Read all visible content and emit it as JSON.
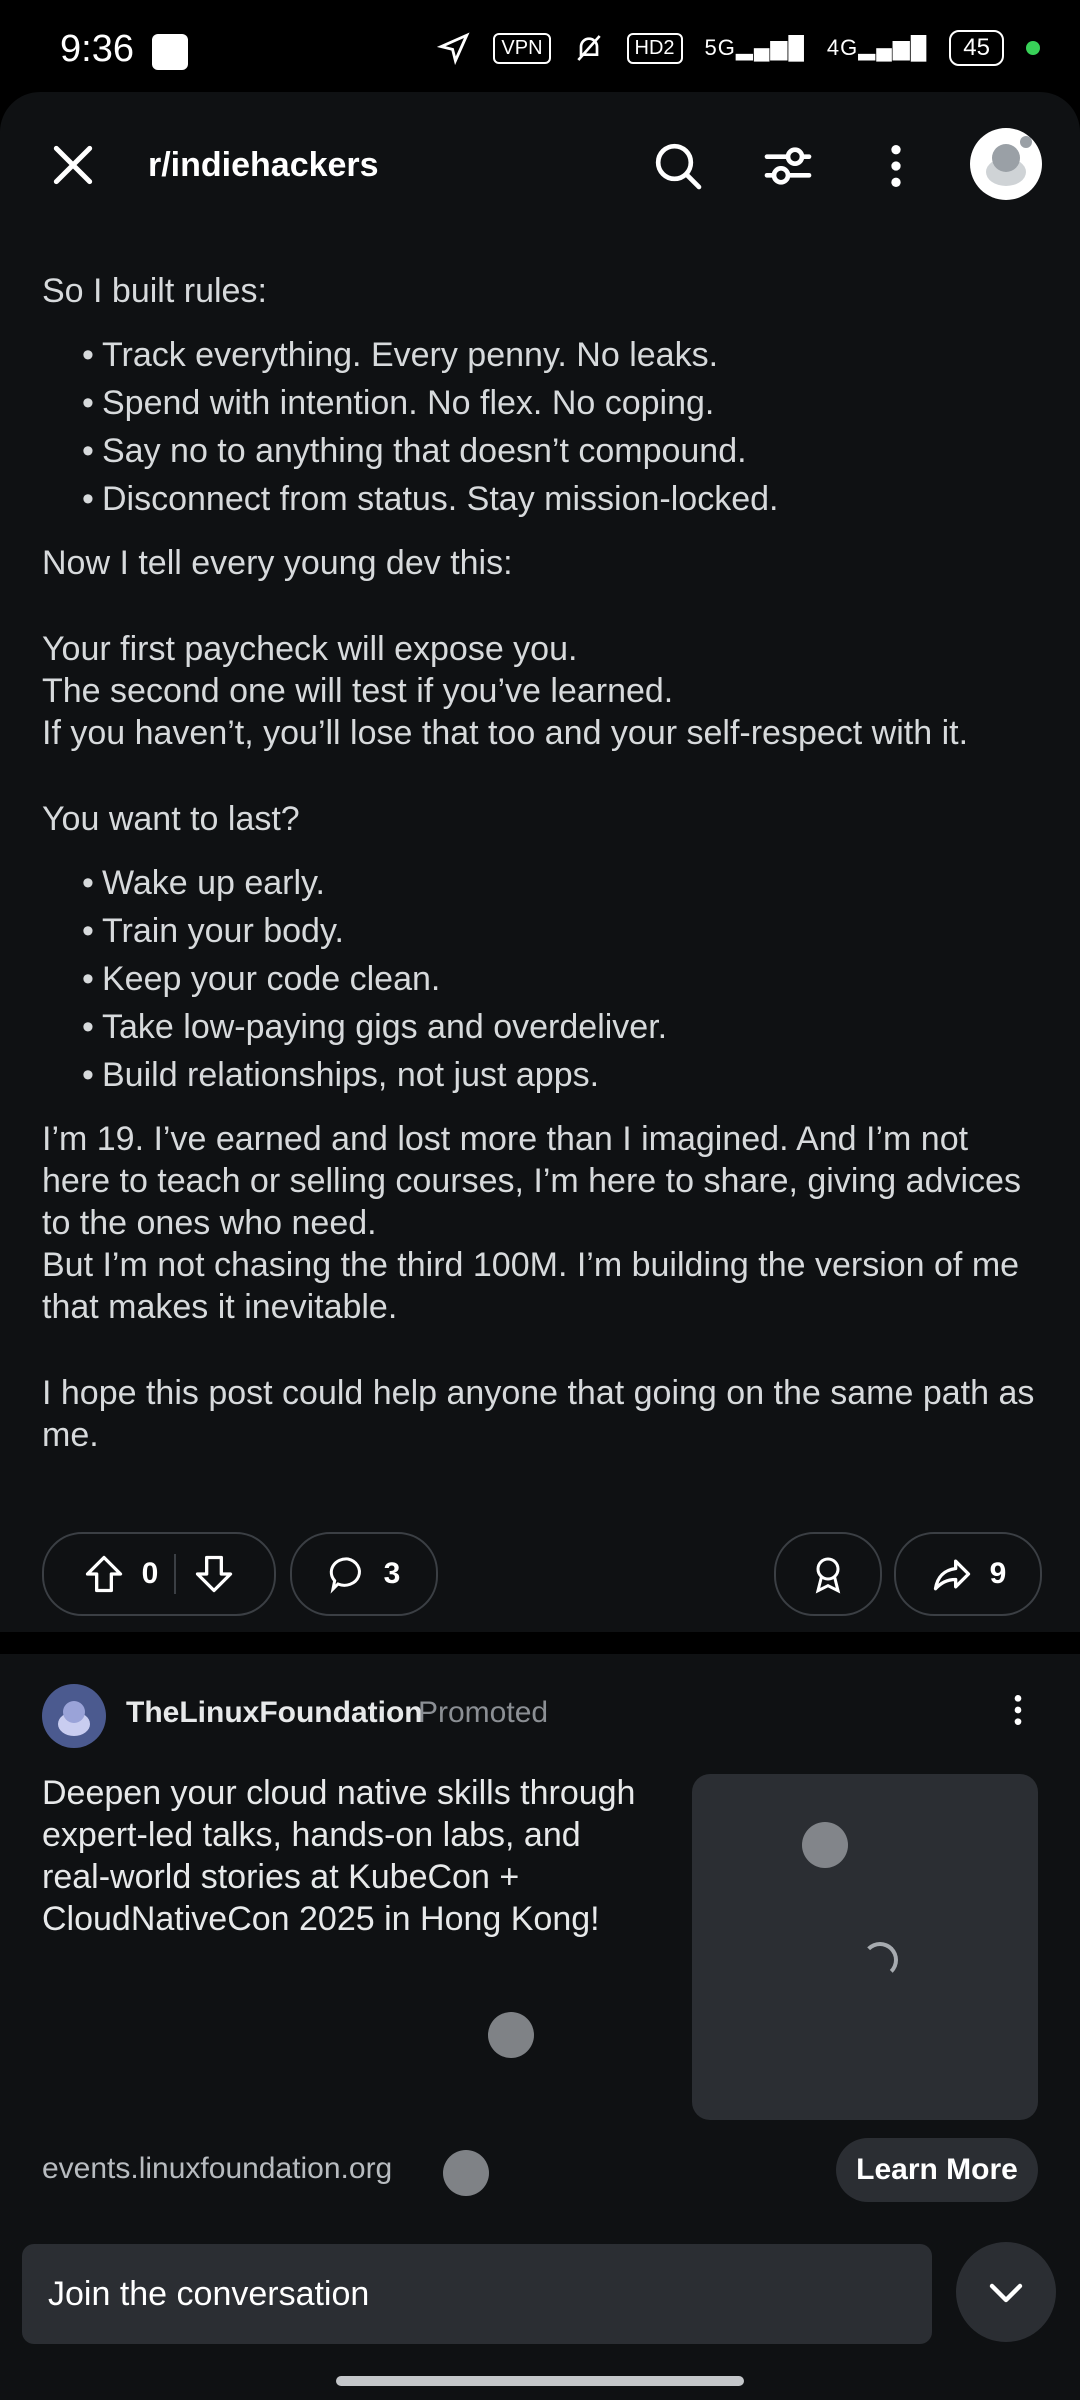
{
  "status": {
    "time": "9:36",
    "vpn": "VPN",
    "hd": "HD2",
    "net5g": "5G",
    "net4g": "4G",
    "battery": "45"
  },
  "header": {
    "subreddit": "r/indiehackers"
  },
  "post": {
    "intro": "So I built rules:",
    "rules": [
      "Track everything. Every penny. No leaks.",
      "Spend with intention. No flex. No coping.",
      "Say no to anything that doesn’t compound.",
      "Disconnect from status. Stay mission-locked."
    ],
    "tell": "Now I tell every young dev this:",
    "paycheck": [
      "Your first paycheck will expose you.",
      "The second one will test if you’ve learned.",
      "If you haven’t, you’ll lose that too and your self-respect with it."
    ],
    "last_q": "You want to last?",
    "last_items": [
      "Wake up early.",
      "Train your body.",
      "Keep your code clean.",
      "Take low-paying gigs and overdeliver.",
      "Build relationships, not just apps."
    ],
    "para1": "I’m 19. I’ve earned and lost more than I imagined. And I’m not here to teach or selling courses, I’m here to share, giving advices to the ones who need.",
    "para2": "But I’m not chasing the third 100M. I’m building the version of me that makes it inevitable.",
    "closing": "I hope this post could help anyone that going on the same path as me."
  },
  "actions": {
    "votes": "0",
    "comments": "3",
    "shares": "9"
  },
  "promo": {
    "advertiser": "TheLinuxFoundation",
    "promoted": "Promoted",
    "text": "Deepen your cloud native skills through expert-led talks, hands-on labs, and real-world stories at KubeCon + CloudNativeCon 2025 in Hong Kong!",
    "domain": "events.linuxfoundation.org",
    "cta": "Learn More"
  },
  "bottom": {
    "placeholder": "Join the conversation"
  }
}
